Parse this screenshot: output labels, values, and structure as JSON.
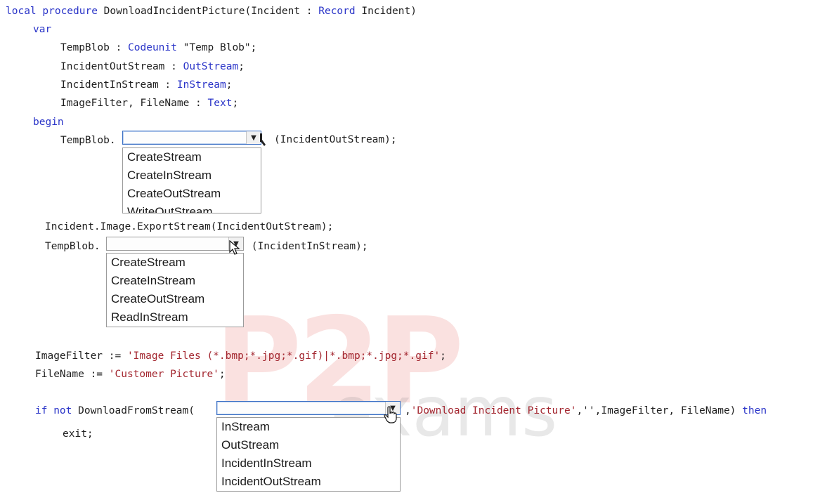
{
  "code": {
    "signature": {
      "kw": "local procedure",
      "name": " DownloadIncidentPicture(Incident : ",
      "record": "Record",
      "rec_name": " Incident)"
    },
    "var_kw": "var",
    "decls": [
      {
        "name": "TempBlob : ",
        "type": "Codeunit",
        "rest": " \"Temp Blob\";"
      },
      {
        "name": "IncidentOutStream : ",
        "type": "OutStream",
        "rest": ";"
      },
      {
        "name": "IncidentInStream : ",
        "type": "InStream",
        "rest": ";"
      },
      {
        "name": "ImageFilter, FileName : ",
        "type": "Text",
        "rest": ";"
      }
    ],
    "begin_kw": "begin",
    "line_tempblob1_prefix": "TempBlob.",
    "line_tempblob1_suffix": "(IncidentOutStream);",
    "line_export": "Incident.Image.ExportStream(IncidentOutStream);",
    "line_tempblob2_prefix": "TempBlob.",
    "line_tempblob2_suffix": " (IncidentInStream);",
    "line_filter_prefix": "ImageFilter := ",
    "line_filter_str": "'Image Files (*.bmp;*.jpg;*.gif)|*.bmp;*.jpg;*.gif'",
    "line_filter_end": ";",
    "line_filename_prefix": "FileName := ",
    "line_filename_str": "'Customer Picture'",
    "line_filename_end": ";",
    "line_if_kw": "if not",
    "line_if_call": " DownloadFromStream(",
    "line_if_str": "'Download Incident Picture'",
    "line_if_after": ",'',ImageFilter, FileName) ",
    "line_if_then": "then",
    "line_if_comma": ",",
    "line_exit": "exit;"
  },
  "dropdown1": {
    "selected": "",
    "options": [
      "CreateStream",
      "CreateInStream",
      "CreateOutStream",
      "WriteOutStream"
    ]
  },
  "dropdown2": {
    "selected": "",
    "options": [
      "CreateStream",
      "CreateInStream",
      "CreateOutStream",
      "ReadInStream"
    ]
  },
  "dropdown3": {
    "selected": "",
    "options": [
      "InStream",
      "OutStream",
      "IncidentInStream",
      "IncidentOutStream"
    ]
  },
  "watermark": {
    "brand": "P2P",
    "word": "exams"
  }
}
